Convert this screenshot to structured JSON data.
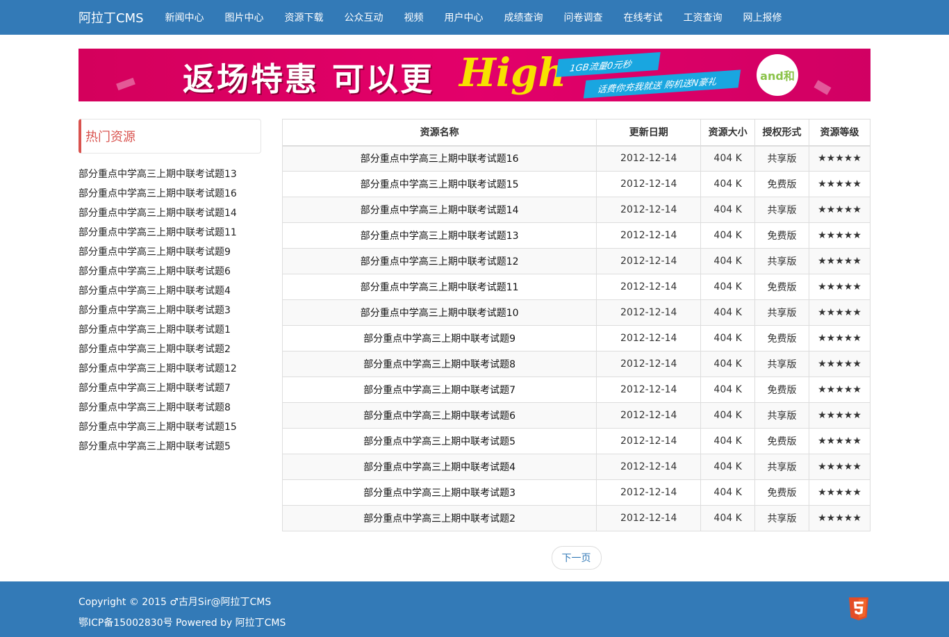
{
  "nav": {
    "brand": "阿拉丁CMS",
    "items": [
      "新闻中心",
      "图片中心",
      "资源下载",
      "公众互动",
      "视频",
      "用户中心",
      "成绩查询",
      "问卷调查",
      "在线考试",
      "工资查询",
      "网上报修"
    ]
  },
  "banner": {
    "main_text": "返场特惠 可以更",
    "high_text": "High",
    "ribbon1": "1GB流量0元秒",
    "ribbon2": "话费你充我就送  购机送N豪礼",
    "logo_text": "and和"
  },
  "sidebar": {
    "title": "热门资源",
    "items": [
      "部分重点中学高三上期中联考试题13",
      "部分重点中学高三上期中联考试题16",
      "部分重点中学高三上期中联考试题14",
      "部分重点中学高三上期中联考试题11",
      "部分重点中学高三上期中联考试题9",
      "部分重点中学高三上期中联考试题6",
      "部分重点中学高三上期中联考试题4",
      "部分重点中学高三上期中联考试题3",
      "部分重点中学高三上期中联考试题1",
      "部分重点中学高三上期中联考试题2",
      "部分重点中学高三上期中联考试题12",
      "部分重点中学高三上期中联考试题7",
      "部分重点中学高三上期中联考试题8",
      "部分重点中学高三上期中联考试题15",
      "部分重点中学高三上期中联考试题5"
    ]
  },
  "table": {
    "headers": [
      "资源名称",
      "更新日期",
      "资源大小",
      "授权形式",
      "资源等级"
    ],
    "rows": [
      [
        "部分重点中学高三上期中联考试题16",
        "2012-12-14",
        "404 K",
        "共享版",
        "★★★★★"
      ],
      [
        "部分重点中学高三上期中联考试题15",
        "2012-12-14",
        "404 K",
        "免费版",
        "★★★★★"
      ],
      [
        "部分重点中学高三上期中联考试题14",
        "2012-12-14",
        "404 K",
        "共享版",
        "★★★★★"
      ],
      [
        "部分重点中学高三上期中联考试题13",
        "2012-12-14",
        "404 K",
        "免费版",
        "★★★★★"
      ],
      [
        "部分重点中学高三上期中联考试题12",
        "2012-12-14",
        "404 K",
        "共享版",
        "★★★★★"
      ],
      [
        "部分重点中学高三上期中联考试题11",
        "2012-12-14",
        "404 K",
        "免费版",
        "★★★★★"
      ],
      [
        "部分重点中学高三上期中联考试题10",
        "2012-12-14",
        "404 K",
        "共享版",
        "★★★★★"
      ],
      [
        "部分重点中学高三上期中联考试题9",
        "2012-12-14",
        "404 K",
        "免费版",
        "★★★★★"
      ],
      [
        "部分重点中学高三上期中联考试题8",
        "2012-12-14",
        "404 K",
        "共享版",
        "★★★★★"
      ],
      [
        "部分重点中学高三上期中联考试题7",
        "2012-12-14",
        "404 K",
        "免费版",
        "★★★★★"
      ],
      [
        "部分重点中学高三上期中联考试题6",
        "2012-12-14",
        "404 K",
        "共享版",
        "★★★★★"
      ],
      [
        "部分重点中学高三上期中联考试题5",
        "2012-12-14",
        "404 K",
        "免费版",
        "★★★★★"
      ],
      [
        "部分重点中学高三上期中联考试题4",
        "2012-12-14",
        "404 K",
        "共享版",
        "★★★★★"
      ],
      [
        "部分重点中学高三上期中联考试题3",
        "2012-12-14",
        "404 K",
        "免费版",
        "★★★★★"
      ],
      [
        "部分重点中学高三上期中联考试题2",
        "2012-12-14",
        "404 K",
        "共享版",
        "★★★★★"
      ]
    ]
  },
  "pager": {
    "next_label": "下一页"
  },
  "footer": {
    "copyright": "Copyright © 2015 ♂古月Sir@阿拉丁CMS",
    "icp": "鄂ICP备15002830号 Powered by 阿拉丁CMS",
    "html5_icon": "html5-icon"
  },
  "colors": {
    "primary": "#337ab7",
    "accent_red": "#d9534f",
    "banner_pink": "#e3006a"
  }
}
